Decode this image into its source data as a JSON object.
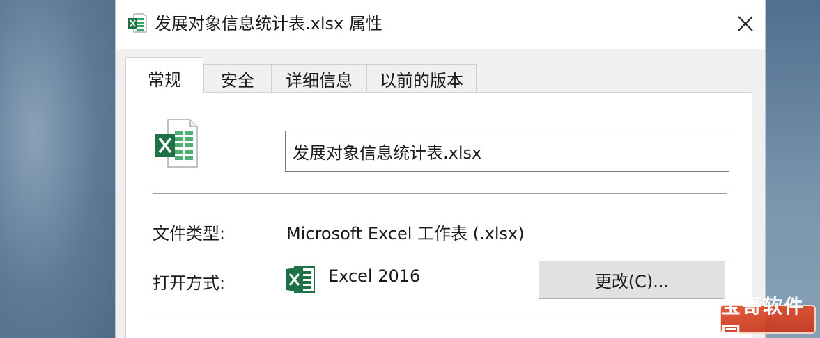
{
  "window": {
    "title": "发展对象信息统计表.xlsx 属性"
  },
  "tabs": [
    {
      "label": "常规",
      "active": true
    },
    {
      "label": "安全",
      "active": false
    },
    {
      "label": "详细信息",
      "active": false
    },
    {
      "label": "以前的版本",
      "active": false
    }
  ],
  "general": {
    "file_name": "发展对象信息统计表.xlsx",
    "file_type_label": "文件类型:",
    "file_type_value": "Microsoft Excel 工作表 (.xlsx)",
    "open_with_label": "打开方式:",
    "open_with_app": "Excel 2016",
    "change_button": "更改(C)..."
  },
  "watermark": {
    "text": "宝哥软件园"
  },
  "icons": {
    "title": "excel-file-icon",
    "file": "excel-file-icon",
    "app": "excel-app-icon",
    "close": "close-icon"
  },
  "colors": {
    "excel_green": "#1e7145",
    "excel_light_green": "#33a466",
    "window_bg": "#f0f0f0",
    "panel_bg": "#ffffff"
  }
}
